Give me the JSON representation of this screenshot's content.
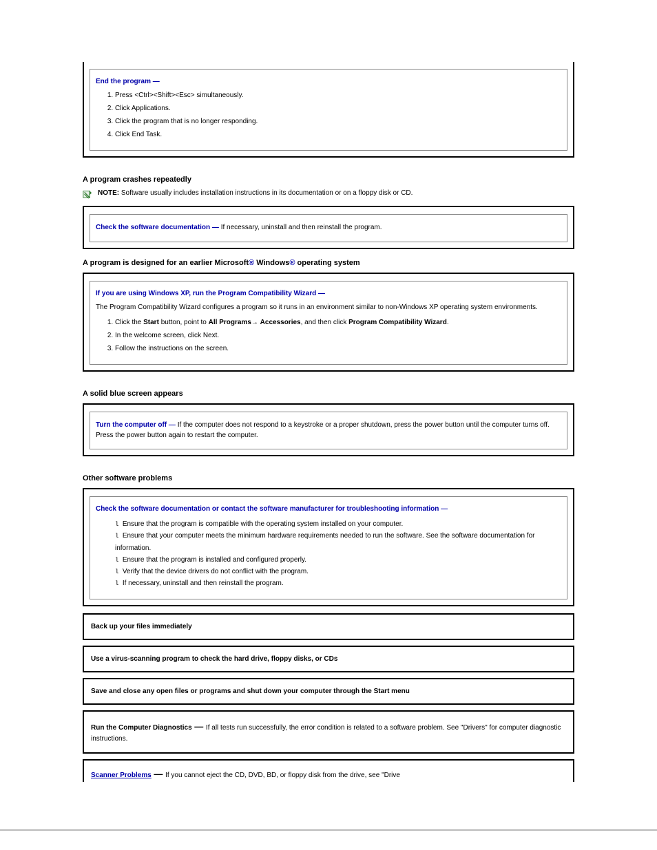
{
  "box1": {
    "lead": "End the program —",
    "steps": [
      "Press <Ctrl><Shift><Esc> simultaneously.",
      "Click Applications.",
      "Click the program that is no longer responding.",
      "Click End Task."
    ]
  },
  "section_crash": "A program crashes repeatedly",
  "note": {
    "label": "NOTE:",
    "text": "Software usually includes installation instructions in its documentation or on a floppy disk or CD."
  },
  "box2": {
    "lead": "Check the software documentation —",
    "tail": "If necessary, uninstall and then reinstall the program."
  },
  "earlier_heading": {
    "pre": "A program is designed for an earlier Microsoft",
    "mid": " Windows",
    "post": " operating system"
  },
  "box3": {
    "lead": "If you are using Windows XP, run the Program Compatibility Wizard —",
    "para": "The Program Compatibility Wizard configures a program so it runs in an environment similar to non-Windows XP operating system environments.",
    "steps": [
      "Click the Start button, point to All Programs→ Accessories, and then click Program Compatibility Wizard.",
      "In the welcome screen, click Next.",
      "Follow the instructions on the screen."
    ]
  },
  "section_blue": "A solid blue screen appears",
  "box4": {
    "lead": "Turn the computer off —",
    "tail": "If the computer does not respond to a keystroke or a proper shutdown, press the power button until the computer turns off. Press the power button again to restart the computer."
  },
  "section_other": "Other software problems",
  "box5": {
    "lead": "Check the software documentation or contact the software manufacturer for troubleshooting information —",
    "bullets": [
      "Ensure that the program is compatible with the operating system installed on your computer.",
      "Ensure that your computer meets the minimum hardware requirements needed to run the software. See the software documentation for information.",
      "Ensure that the program is installed and configured properly.",
      "Verify that the device drivers do not conflict with the program.",
      "If necessary, uninstall and then reinstall the program."
    ]
  },
  "row1": "Back up your files immediately",
  "row2": "Use a virus-scanning program to check the hard drive, floppy disks, or CDs",
  "row3": "Save and close any open files or programs and shut down your computer through the Start menu",
  "row4": {
    "lead": "Run the Computer Diagnostics",
    "dash": " — ",
    "tail1": "If all tests run successfully, the error condition is related to a software problem. See \"",
    "tail2": "\" for computer diagnostic instructions.",
    "link_placeholder": "Drivers"
  },
  "row5": {
    "link": "Scanner Problems",
    "dash": " — ",
    "tail": "If you cannot eject the CD, DVD, BD, or floppy disk from the drive, see \"Drive"
  }
}
